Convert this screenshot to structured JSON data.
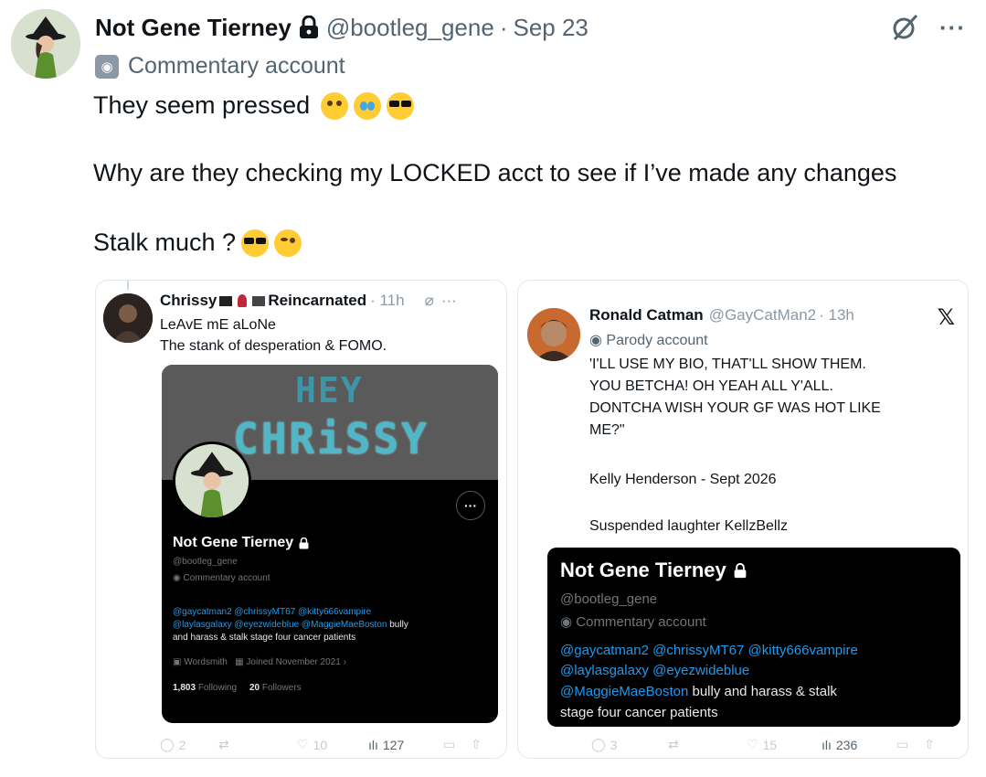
{
  "tweet": {
    "author_name": "Not Gene Tierney",
    "handle": "@bootleg_gene",
    "date": "Sep 23",
    "label": "Commentary account",
    "line1": "They seem pressed",
    "line2": "Why are they checking my LOCKED acct to see if I’ve made any changes",
    "line3": "Stalk much ?"
  },
  "left_card": {
    "name_part1": "Chrissy",
    "name_part2": "Reincarnated",
    "time": "· 11h",
    "line1": "LeAvE mE aLoNe",
    "line2": "The stank of desperation & FOMO.",
    "banner_line1": "HEY",
    "banner_line2": "CHRiSSY",
    "profile": {
      "name": "Not Gene Tierney",
      "handle": "@bootleg_gene",
      "label": "Commentary account",
      "mentions1": "@gaycatman2 @chrissyMT67 @kitty666vampire",
      "mentions2": "@laylasgalaxy @eyezwideblue @MaggieMaeBoston",
      "bio_tail": " bully",
      "bio_line2": "and harass & stalk stage four cancer patients",
      "work": "Wordsmith",
      "joined": "Joined November 2021",
      "following_count": "1,803",
      "following_label": "Following",
      "followers_count": "20",
      "followers_label": "Followers"
    },
    "actions": {
      "replies": "2",
      "reposts": "",
      "likes": "10",
      "views": "127"
    }
  },
  "right_card": {
    "name": "Ronald Catman",
    "handle": "@GayCatMan2",
    "time": "· 13h",
    "label": "Parody account",
    "text_lines": [
      "'I'LL USE MY BIO, THAT'LL SHOW THEM.",
      "YOU BETCHA! OH YEAH ALL Y'ALL.",
      "DONTCHA WISH YOUR GF WAS HOT LIKE",
      "ME?\""
    ],
    "line_kelly": "Kelly Henderson - Sept 2026",
    "line_suspended": "Suspended laughter KellzBellz",
    "profile": {
      "name": "Not Gene Tierney",
      "handle": "@bootleg_gene",
      "label": "Commentary account",
      "mentions1": "@gaycatman2 @chrissyMT67 @kitty666vampire",
      "mentions2": "@laylasgalaxy @eyezwideblue",
      "mentions3": "@MaggieMaeBoston",
      "bio_tail": " bully and harass & stalk",
      "bio_line2": "stage four cancer patients"
    },
    "actions": {
      "replies": "3",
      "reposts": "",
      "likes": "15",
      "views": "236"
    }
  },
  "icons": [
    "lock-icon",
    "grok-icon",
    "more-icon",
    "mask-icon",
    "x-logo-icon",
    "reply-icon",
    "repost-icon",
    "like-icon",
    "views-icon",
    "bookmark-icon",
    "share-icon"
  ]
}
